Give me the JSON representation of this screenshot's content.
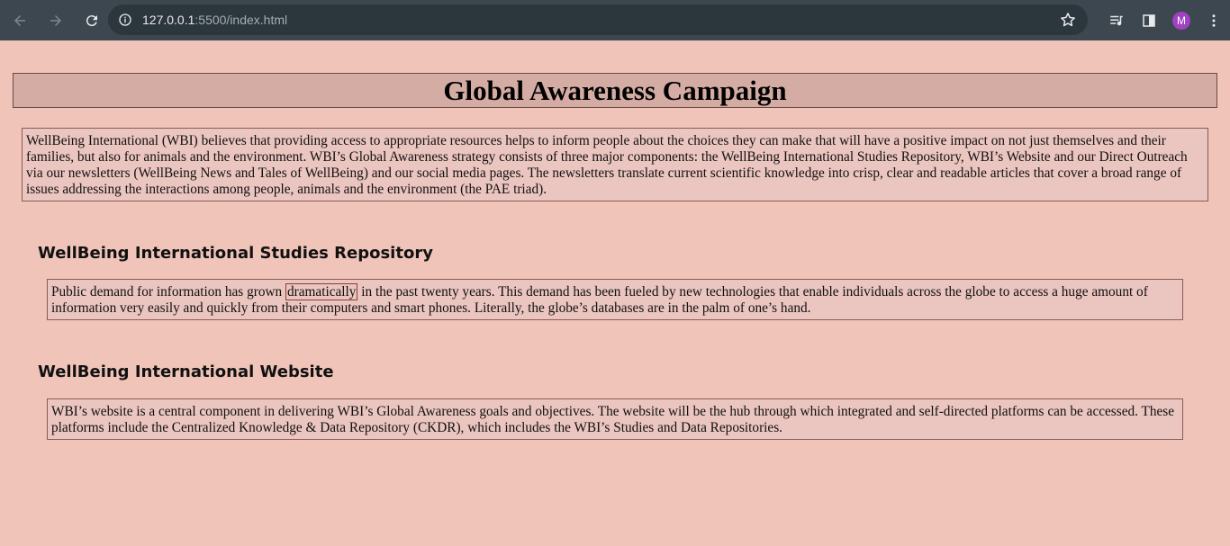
{
  "browser": {
    "url_host": "127.0.0.1",
    "url_path": ":5500/index.html",
    "avatar_letter": "M",
    "avatar_color": "#a142c2"
  },
  "page": {
    "title": "Global Awareness Campaign",
    "intro": "WellBeing International (WBI) believes that providing access to appropriate resources helps to inform people about the choices they can make that will have a positive impact on not just themselves and their families, but also for animals and the environment. WBI’s Global Awareness strategy consists of three major components: the WellBeing International Studies Repository, WBI’s Website and our Direct Outreach via our newsletters (WellBeing News and Tales of WellBeing) and our social media pages. The newsletters translate current scientific knowledge into crisp, clear and readable articles that cover a broad range of issues addressing the interactions among people, animals and the environment (the PAE triad).",
    "sections": [
      {
        "heading": "WellBeing International Studies Repository",
        "text_before": "Public demand for information has grown ",
        "highlight": "dramatically",
        "text_after": " in the past twenty years. This demand has been fueled by new technologies that enable individuals across the globe to access a huge amount of information very easily and quickly from their computers and smart phones. Literally, the globe’s databases are in the palm of one’s hand."
      },
      {
        "heading": "WellBeing International Website",
        "text": "WBI’s website is a central component in delivering WBI’s Global Awareness goals and objectives. The website will be the hub through which integrated and self-directed platforms can be accessed. These platforms include the Centralized Knowledge & Data Repository (CKDR), which includes the WBI’s Studies and Data Repositories."
      }
    ]
  }
}
